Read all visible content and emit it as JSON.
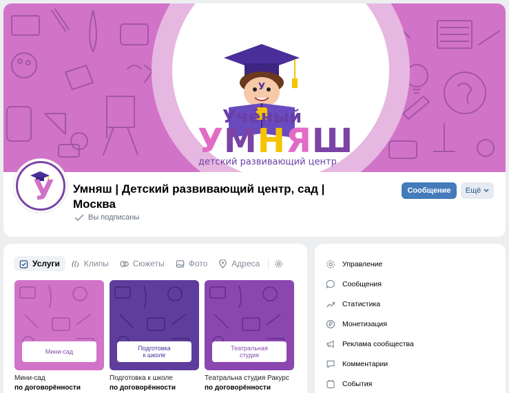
{
  "cover": {
    "brand_top": "Учёный",
    "brand_letters": [
      "У",
      "М",
      "Н",
      "Я",
      "Ш"
    ],
    "brand_colors": [
      "#e36bc6",
      "#7b43a6",
      "#f5c300",
      "#e36bc6",
      "#7b43a6"
    ],
    "brand_sub": "детский развивающий центр",
    "book_letter": "У"
  },
  "group": {
    "title": "Умняш | Детский развивающий центр, сад | Москва",
    "subscribed": "Вы подписаны",
    "avatar_letter": "У"
  },
  "actions": {
    "message": "Сообщение",
    "more": "Ещё"
  },
  "tabs": [
    {
      "label": "Услуги",
      "icon": "services-icon",
      "active": true
    },
    {
      "label": "Клипы",
      "icon": "clips-icon",
      "active": false
    },
    {
      "label": "Сюжеты",
      "icon": "stories-icon",
      "active": false
    },
    {
      "label": "Фото",
      "icon": "photo-icon",
      "active": false
    },
    {
      "label": "Адреса",
      "icon": "location-icon",
      "active": false
    }
  ],
  "services": [
    {
      "badge": "Мини-сад",
      "name": "Мини-сад",
      "price": "по договорённости",
      "bg": "#d173c8"
    },
    {
      "badge": "Подготовка\nк школе",
      "name": "Подготовка к школе",
      "price": "по договорённости",
      "bg": "#5e3d9c"
    },
    {
      "badge": "Театральная\nстудия",
      "name": "Театральна студия Ракурс",
      "price": "по договорённости",
      "bg": "#8a47b0"
    }
  ],
  "manage": [
    {
      "label": "Управление",
      "icon": "gear-icon"
    },
    {
      "label": "Сообщения",
      "icon": "message-icon"
    },
    {
      "label": "Статистика",
      "icon": "stats-icon"
    },
    {
      "label": "Монетизация",
      "icon": "ruble-icon"
    },
    {
      "label": "Реклама сообщества",
      "icon": "megaphone-icon"
    },
    {
      "label": "Комментарии",
      "icon": "comment-icon"
    },
    {
      "label": "События",
      "icon": "events-icon"
    }
  ],
  "colors": {
    "accent": "#447bba",
    "cover_pink": "#d173c8",
    "brand_purple": "#7b43a6"
  }
}
